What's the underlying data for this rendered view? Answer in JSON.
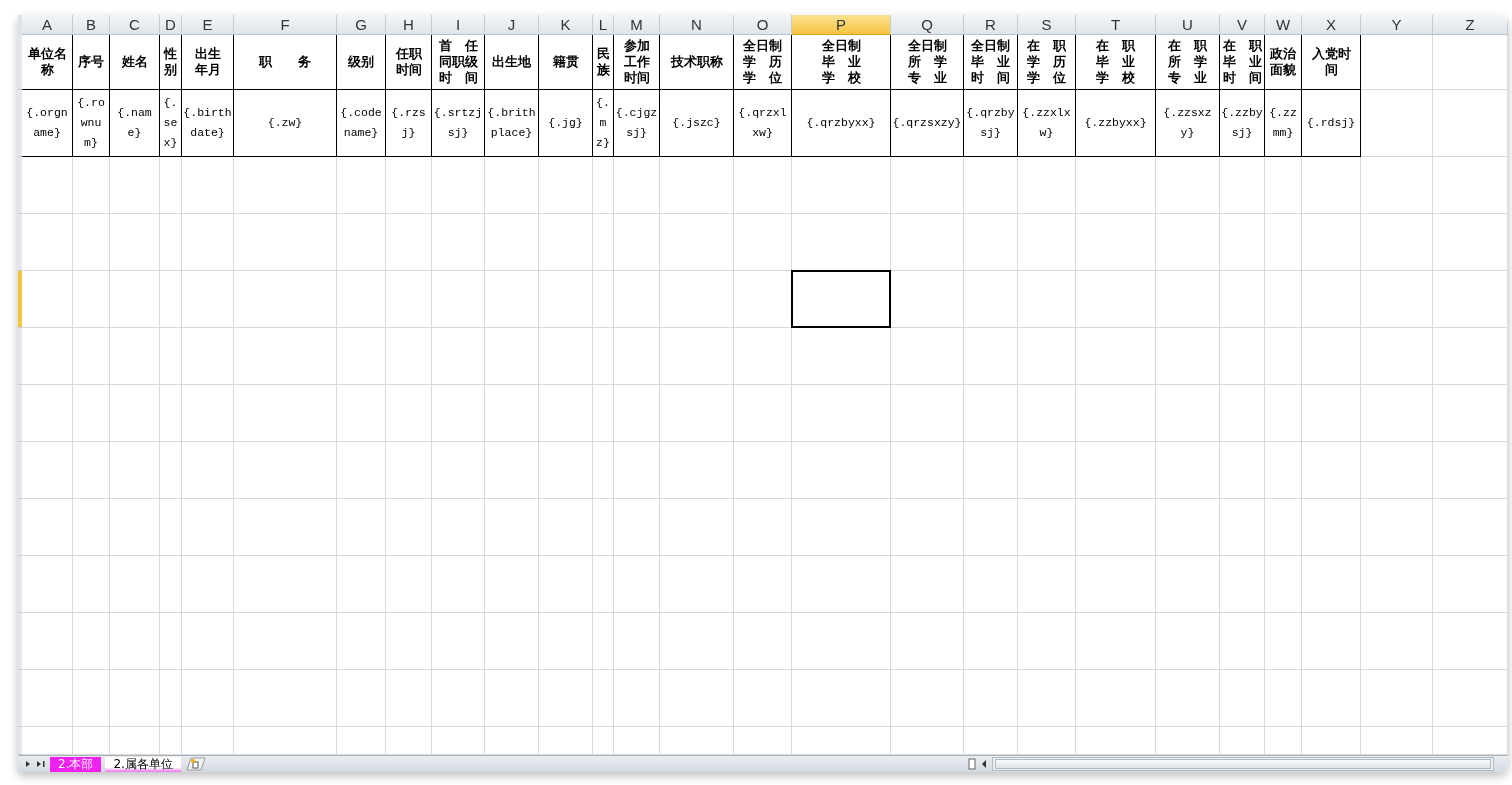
{
  "columns": [
    {
      "letter": "A",
      "header": "单位名称",
      "value": "{.orgname}",
      "selected": false
    },
    {
      "letter": "B",
      "header": "序号",
      "value": "{.rownum}",
      "selected": false
    },
    {
      "letter": "C",
      "header": "姓名",
      "value": "{.name}",
      "selected": false
    },
    {
      "letter": "D",
      "header": "性别",
      "value": "{.sex}",
      "selected": false
    },
    {
      "letter": "E",
      "header": "出生年月",
      "value": "{.birthdate}",
      "selected": false
    },
    {
      "letter": "F",
      "header": "职　　务",
      "value": "{.zw}",
      "selected": false
    },
    {
      "letter": "G",
      "header": "级别",
      "value": "{.codename}",
      "selected": false
    },
    {
      "letter": "H",
      "header": "任职时间",
      "value": "{.rzsj}",
      "selected": false
    },
    {
      "letter": "I",
      "header": "首　任同职级时　间",
      "value": "{.srtzjsj}",
      "selected": false
    },
    {
      "letter": "J",
      "header": "出生地",
      "value": "{.brithplace}",
      "selected": false
    },
    {
      "letter": "K",
      "header": "籍贯",
      "value": "{.jg}",
      "selected": false
    },
    {
      "letter": "L",
      "header": "民族",
      "value": "{.mz}",
      "selected": false
    },
    {
      "letter": "M",
      "header": "参加工作时间",
      "value": "{.cjgzsj}",
      "selected": false
    },
    {
      "letter": "N",
      "header": "技术职称",
      "value": "{.jszc}",
      "selected": false
    },
    {
      "letter": "O",
      "header": "全日制学　历学　位",
      "value": "{.qrzxlxw}",
      "selected": false
    },
    {
      "letter": "P",
      "header": "全日制毕　业学　校",
      "value": "{.qrzbyxx}",
      "selected": true
    },
    {
      "letter": "Q",
      "header": "全日制所　学专　业",
      "value": "{.qrzsxzy}",
      "selected": false
    },
    {
      "letter": "R",
      "header": "全日制毕　业时　间",
      "value": "{.qrzbysj}",
      "selected": false
    },
    {
      "letter": "S",
      "header": "在　职学　历学　位",
      "value": "{.zzxlxw}",
      "selected": false
    },
    {
      "letter": "T",
      "header": "在　职毕　业学　校",
      "value": "{.zzbyxx}",
      "selected": false
    },
    {
      "letter": "U",
      "header": "在　职所　学专　业",
      "value": "{.zzsxzy}",
      "selected": false
    },
    {
      "letter": "V",
      "header": "在　职毕　业时　间",
      "value": "{.zzbysj}",
      "selected": false
    },
    {
      "letter": "W",
      "header": "政治面貌",
      "value": "{.zzmm}",
      "selected": false
    },
    {
      "letter": "X",
      "header": "入党时间",
      "value": "{.rdsj}",
      "selected": false
    },
    {
      "letter": "Y",
      "selected": false
    },
    {
      "letter": "Z",
      "selected": false
    }
  ],
  "empty_rows": [
    {
      "selected": false
    },
    {
      "selected": false
    },
    {
      "selected": true
    },
    {
      "selected": false
    },
    {
      "selected": false
    },
    {
      "selected": false
    },
    {
      "selected": false
    },
    {
      "selected": false
    },
    {
      "selected": false
    },
    {
      "selected": false
    },
    {
      "selected": false
    }
  ],
  "sheet_tabs": [
    {
      "label": "2.本部",
      "selected": false
    },
    {
      "label": "2.属各单位",
      "selected": true
    }
  ]
}
